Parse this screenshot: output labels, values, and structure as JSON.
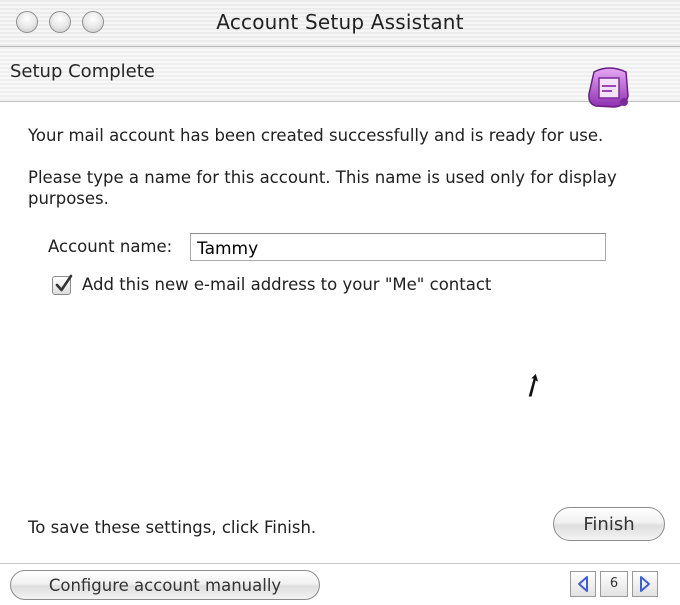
{
  "window": {
    "title": "Account Setup Assistant"
  },
  "header": {
    "step_title": "Setup Complete",
    "app_icon": "entourage-icon"
  },
  "content": {
    "success_message": "Your mail account has been created successfully and is ready for use.",
    "instruction": "Please type a name for this account. This name is used only for display purposes.",
    "account_name_label": "Account name:",
    "account_name_value": "Tammy",
    "add_to_me_contact": {
      "label": "Add this new e-mail address to your \"Me\" contact",
      "checked": true
    },
    "save_hint": "To save these settings, click Finish."
  },
  "buttons": {
    "finish": "Finish",
    "configure_manually": "Configure account manually"
  },
  "pager": {
    "current_page": "6",
    "prev_icon": "triangle-left-icon",
    "next_icon": "triangle-right-icon"
  },
  "colors": {
    "accent_purple": "#b04fd1",
    "pager_arrow": "#3d5fd6"
  }
}
